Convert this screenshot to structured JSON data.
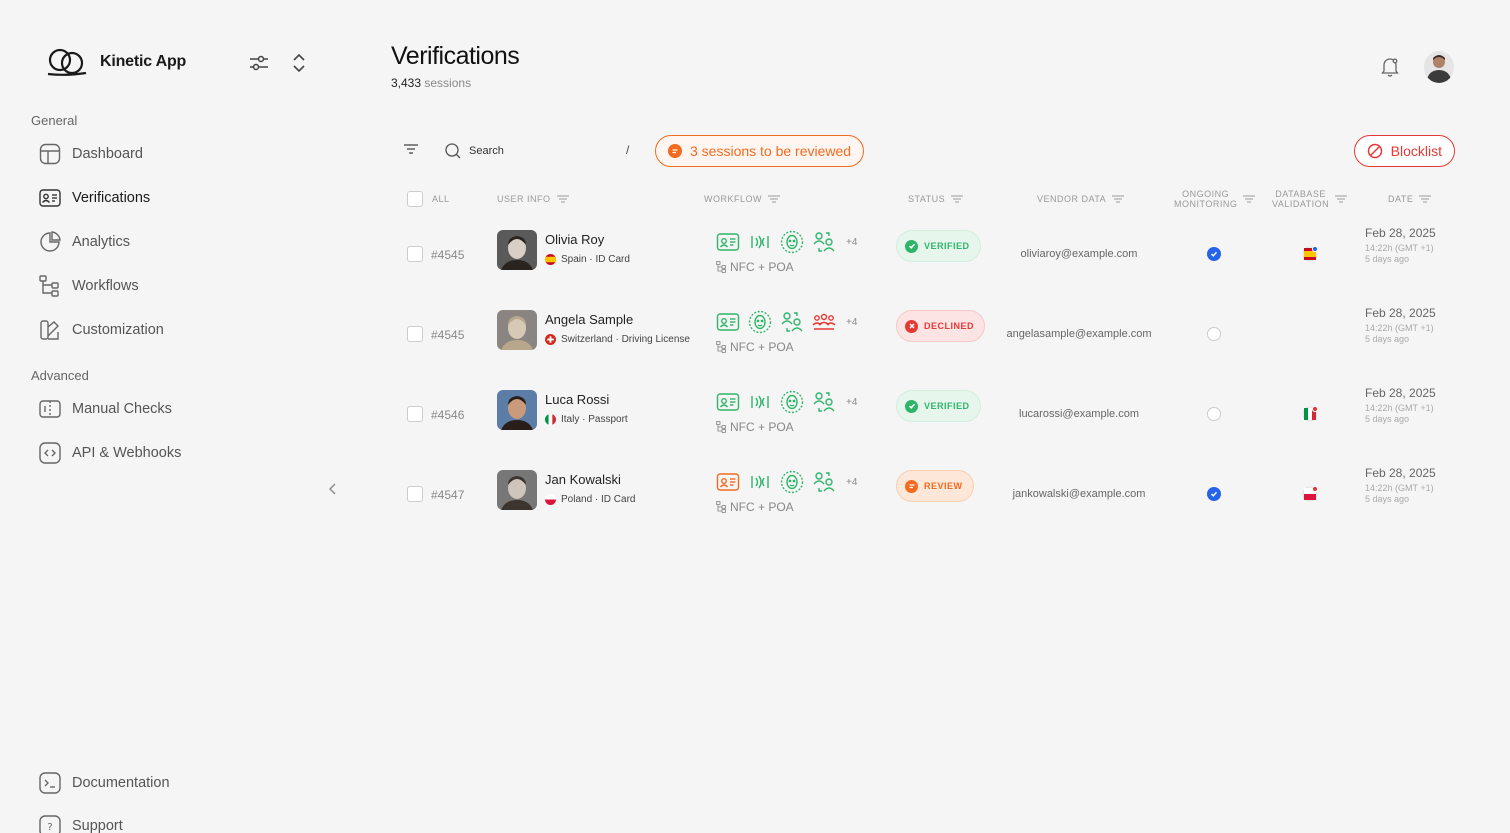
{
  "app": {
    "name": "Kinetic App"
  },
  "sidebar": {
    "general_label": "General",
    "advanced_label": "Advanced",
    "general_items": [
      {
        "label": "Dashboard",
        "icon": "dashboard-icon"
      },
      {
        "label": "Verifications",
        "icon": "id-card-icon",
        "active": true
      },
      {
        "label": "Analytics",
        "icon": "pie-chart-icon"
      },
      {
        "label": "Workflows",
        "icon": "workflow-icon"
      },
      {
        "label": "Customization",
        "icon": "palette-icon"
      }
    ],
    "advanced_items": [
      {
        "label": "Manual Checks",
        "icon": "manual-check-icon"
      },
      {
        "label": "API & Webhooks",
        "icon": "code-icon"
      }
    ],
    "footer_items": [
      {
        "label": "Documentation",
        "icon": "terminal-icon"
      },
      {
        "label": "Support",
        "icon": "help-icon"
      }
    ]
  },
  "header": {
    "title": "Verifications",
    "session_count": "3,433",
    "session_suffix": "sessions"
  },
  "toolbar": {
    "search_placeholder": "Search",
    "search_shortcut": "/",
    "review_label": "3 sessions to be reviewed",
    "blocklist_label": "Blocklist"
  },
  "table": {
    "columns": {
      "all": "ALL",
      "user_info": "USER INFO",
      "workflow": "WORKFLOW",
      "status": "STATUS",
      "vendor_data": "VENDOR DATA",
      "ongoing_1": "ONGOING",
      "ongoing_2": "MONITORING",
      "database_1": "DATABASE",
      "database_2": "VALIDATION",
      "date": "DATE"
    },
    "rows": [
      {
        "id": "#4545",
        "name": "Olivia Roy",
        "doc": "Spain · ID Card",
        "country": "spain",
        "workflow_more": "+4",
        "workflow_sub": "NFC + POA",
        "status": "VERIFIED",
        "vendor": "oliviaroy@example.com",
        "monitoring": true,
        "db_flag": "spain",
        "date": "Feb 28, 2025",
        "time": "14:22h (GMT +1)",
        "ago": "5 days ago"
      },
      {
        "id": "#4545",
        "name": "Angela Sample",
        "doc": "Switzerland · Driving License",
        "country": "switzerland",
        "workflow_more": "+4",
        "workflow_sub": "NFC + POA",
        "status": "DECLINED",
        "vendor": "angelasample@example.com",
        "monitoring": false,
        "db_flag": "",
        "date": "Feb 28, 2025",
        "time": "14:22h (GMT +1)",
        "ago": "5 days ago"
      },
      {
        "id": "#4546",
        "name": "Luca Rossi",
        "doc": "Italy · Passport",
        "country": "italy",
        "workflow_more": "+4",
        "workflow_sub": "NFC + POA",
        "status": "VERIFIED",
        "vendor": "lucarossi@example.com",
        "monitoring": false,
        "db_flag": "italy",
        "date": "Feb 28, 2025",
        "time": "14:22h (GMT +1)",
        "ago": "5 days ago"
      },
      {
        "id": "#4547",
        "name": "Jan Kowalski",
        "doc": "Poland · ID Card",
        "country": "poland",
        "workflow_more": "+4",
        "workflow_sub": "NFC + POA",
        "status": "REVIEW",
        "vendor": "jankowalski@example.com",
        "monitoring": true,
        "db_flag": "poland",
        "date": "Feb 28, 2025",
        "time": "14:22h (GMT +1)",
        "ago": "5 days ago"
      }
    ]
  },
  "colors": {
    "verified": "#2fb56a",
    "declined": "#e53935",
    "review": "#f26b21",
    "monitoring_on": "#2563eb"
  }
}
